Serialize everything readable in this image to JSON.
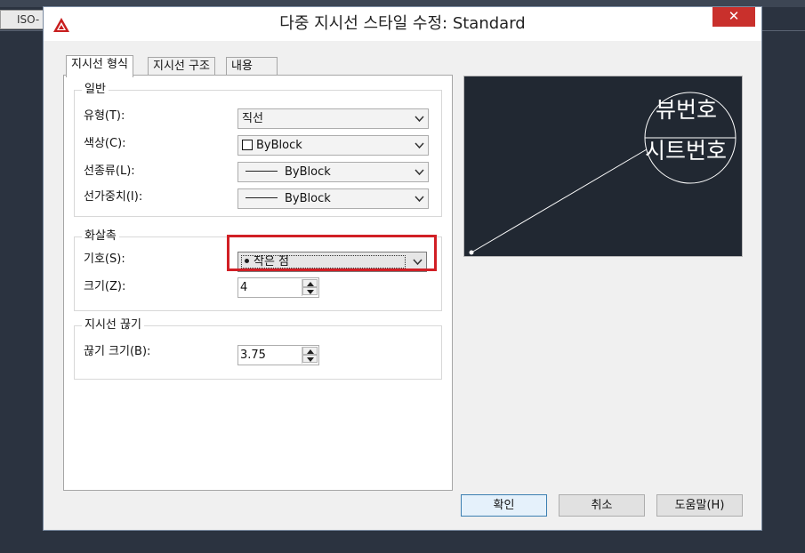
{
  "background": {
    "tab_label": "ISO-"
  },
  "dialog": {
    "title": "다중 지시선 스타일 수정: Standard",
    "close_glyph": "✕",
    "tabs": [
      {
        "label": "지시선 형식"
      },
      {
        "label": "지시선 구조"
      },
      {
        "label": "내용"
      }
    ],
    "general": {
      "title": "일반",
      "type_label": "유형(T):",
      "type_value": "직선",
      "color_label": "색상(C):",
      "color_value": "ByBlock",
      "linetype_label": "선종류(L):",
      "linetype_value": "ByBlock",
      "lineweight_label": "선가중치(I):",
      "lineweight_value": "ByBlock"
    },
    "arrowhead": {
      "title": "화살촉",
      "symbol_label": "기호(S):",
      "symbol_value": "작은 점",
      "size_label": "크기(Z):",
      "size_value": "4"
    },
    "leader_break": {
      "title": "지시선 끊기",
      "break_size_label": "끊기 크기(B):",
      "break_size_value": "3.75"
    },
    "preview": {
      "top_text": "뷰번호",
      "bottom_text": "시트번호"
    },
    "buttons": {
      "ok": "확인",
      "cancel": "취소",
      "help": "도움말(H)"
    },
    "colors": {
      "preview_bg": "#212832",
      "highlight": "#d11f25",
      "close_bg": "#c9302c"
    }
  }
}
